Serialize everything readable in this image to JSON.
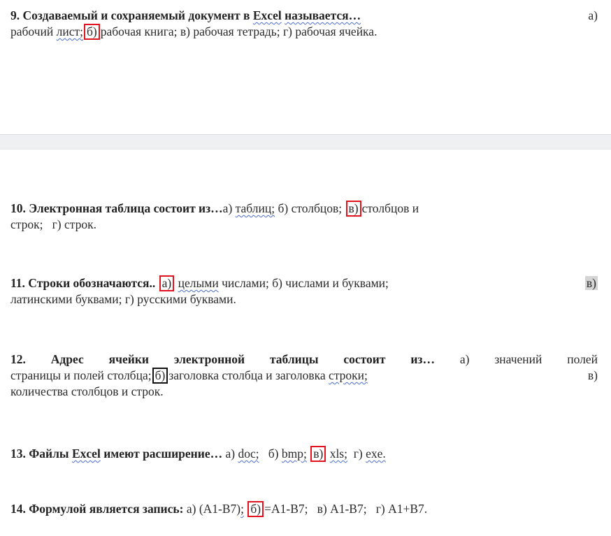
{
  "q9": {
    "num_title": "9. Создаваемый и сохраняемый документ в",
    "excel": "Excel",
    "title_end": "называется…",
    "opt_a_label": "а)",
    "opt_a_text": "рабочий",
    "opt_a_word": "лист;",
    "opt_b_label": "б)",
    "opt_b_text": "рабочая книга;",
    "opt_v": "в) рабочая тетрадь;",
    "opt_g": "г) рабочая ячейка."
  },
  "q10": {
    "title": "10. Электронная таблица состоит из…",
    "opt_a_label": "а)",
    "opt_a_word": "таблиц;",
    "opt_b": "б) столбцов;",
    "opt_v_label": "в)",
    "opt_v_text": "столбцов и",
    "opt_v_cont": "строк;",
    "opt_g": "г) строк."
  },
  "q11": {
    "title": "11. Строки обозначаются..",
    "opt_a_label": "а)",
    "opt_a_word": "целыми",
    "opt_a_text": "числами;",
    "opt_b": "б) числами и буквами;",
    "opt_v_label": "в)",
    "opt_v_text": "латинскими буквами;",
    "opt_g": "г) русскими буквами."
  },
  "q12": {
    "title": "12. Адрес ячейки электронной таблицы состоит из…",
    "opt_a": "а) значений полей",
    "opt_a_cont": "страницы и полей столбца;",
    "opt_b_label": "б)",
    "opt_b_text": "заголовка столбца и заголовка",
    "opt_b_word": "строки;",
    "opt_v_label": "в)",
    "opt_v_text": "количества столбцов и строк."
  },
  "q13": {
    "title_start": "13. Файлы",
    "excel": "Excel",
    "title_end": "имеют расширение…",
    "opt_a_label": "а)",
    "opt_a_word": "doc;",
    "opt_b_label": "б)",
    "opt_b_word": "bmp;",
    "opt_v_label": "в)",
    "opt_v_word": "xls;",
    "opt_g_label": "г)",
    "opt_g_word": "exe."
  },
  "q14": {
    "title": "14. Формулой является запись:",
    "opt_a_label": "а) (A1-B7)",
    "opt_a_sep": ";",
    "opt_b_label": "б)",
    "opt_b_text": "=A1-B7;",
    "opt_v": "в) A1-B7;",
    "opt_g": "г) A1+B7."
  }
}
